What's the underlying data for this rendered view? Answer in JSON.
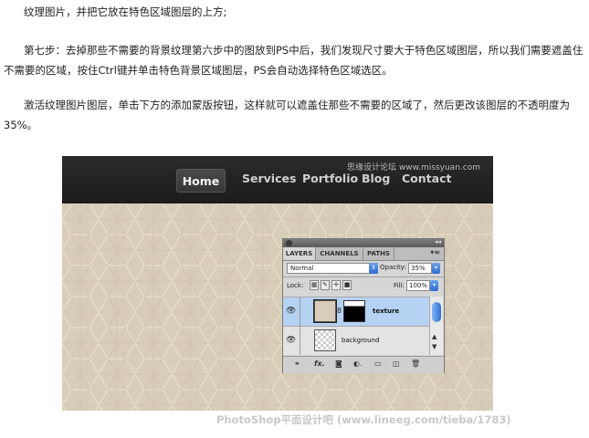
{
  "article": {
    "p1": "纹理图片，并把它放在特色区域图层的上方;",
    "p2": "第七步：去掉那些不需要的背景纹理第六步中的图放到PS中后，我们发现尺寸要大于特色区域图层，所以我们需要遮盖住不需要的区域，按住Ctrl键并单击特色背景区域图层，PS会自动选择特色区域选区。",
    "p3": "激活纹理图片图层，单击下方的添加蒙版按钮，这样就可以遮盖住那些不需要的区域了，然后更改该图层的不透明度为35%。"
  },
  "screenshot": {
    "nav": [
      "Home",
      "Services",
      "Portfolio",
      "Blog",
      "Contact"
    ],
    "watermark_top": "思缘设计论坛  www.missyuan.com",
    "panel": {
      "tabs": [
        "LAYERS",
        "CHANNELS",
        "PATHS"
      ],
      "blend_mode": "Normal",
      "opacity_label": "Opacity:",
      "opacity_value": "35%",
      "lock_label": "Lock:",
      "fill_label": "Fill:",
      "fill_value": "100%",
      "layers": [
        {
          "name": "texture",
          "selected": true,
          "has_mask": true
        },
        {
          "name": "background",
          "selected": false,
          "has_mask": false
        }
      ]
    },
    "colors": {
      "nav_bg": "#222222",
      "texture": "#d8cdb8",
      "selection": "#b6d2f3"
    }
  },
  "watermark_bottom": "PhotoShop平面设计吧 (www.lineeg.com/tieba/1783)"
}
